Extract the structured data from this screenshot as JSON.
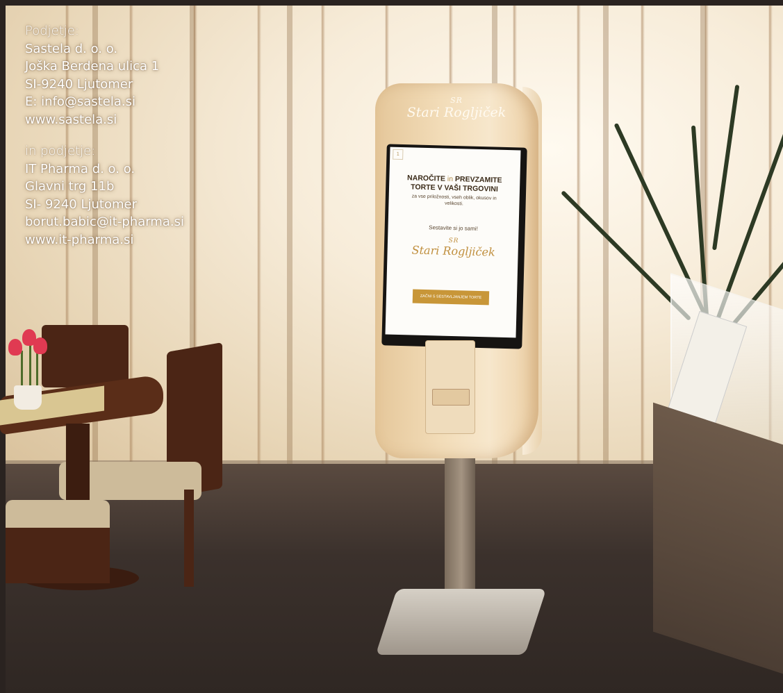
{
  "company_block_1": {
    "heading": "Podjetje:",
    "lines": [
      "Sastela d. o. o.",
      "Joška Berdena ulica 1",
      "SI-9240 Ljutomer",
      "E: info@sastela.si",
      "www.sastela.si"
    ]
  },
  "company_block_2": {
    "heading": "in podjetje:",
    "lines": [
      "IT Pharma d. o. o.",
      "Glavni trg 11b",
      "SI- 9240 Ljutomer",
      "borut.babic@it-pharma.si",
      "www.it-pharma.si"
    ]
  },
  "kiosk": {
    "logo_mark": "SR",
    "logo_name": "Stari Rogljiček",
    "screen": {
      "corner": "1",
      "headline_part1": "NAROČITE",
      "headline_in": "in",
      "headline_part2": "PREVZAMITE",
      "headline_line2": "TORTE V VAŠI TRGOVINI",
      "subtext": "za vse priložnosti, vseh oblik, okusov in velikosti.",
      "call_to_action": "Sestavite si jo sami!",
      "logo_mark": "SR",
      "logo_name": "Stari Rogljiček",
      "button_label": "ZAČNI S SESTAVLJANJEM TORTE"
    }
  },
  "colors": {
    "overlay_text": "#ffffff",
    "kiosk_gold": "#c89638",
    "kiosk_body": "#f2dcb8"
  }
}
